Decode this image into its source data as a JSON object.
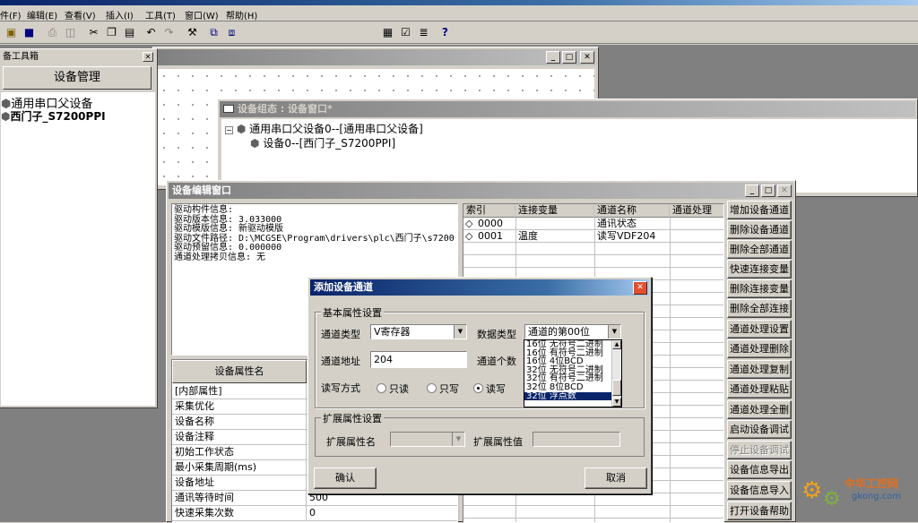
{
  "menu": [
    "件(F)",
    "编辑(E)",
    "查看(V)",
    "插入(I)",
    "工具(T)",
    "窗口(W)",
    "帮助(H)"
  ],
  "toolbox": {
    "title": "备工具箱",
    "header_button": "设备管理",
    "items": [
      "通用串口父设备",
      "西门子_S7200PPI"
    ]
  },
  "device_config": {
    "title": "设备组态 : 设备窗口*",
    "tree_parent": "通用串口父设备0--[通用串口父设备]",
    "tree_child": "设备0--[西门子_S7200PPI]"
  },
  "editor": {
    "title": "设备编辑窗口",
    "info_lines": [
      "驱动构件信息:",
      "驱动版本信息: 3.033000",
      "驱动模版信息: 新驱动模版",
      "驱动文件路径: D:\\MCGSE\\Program\\drivers\\plc\\西门子\\s7200",
      "驱动预留信息: 0.000000",
      "通道处理拷贝信息: 无"
    ],
    "prop_header": "设备属性名",
    "props": [
      {
        "name": "[内部属性]",
        "value": ""
      },
      {
        "name": "采集优化",
        "value": ""
      },
      {
        "name": "设备名称",
        "value": ""
      },
      {
        "name": "设备注释",
        "value": ""
      },
      {
        "name": "初始工作状态",
        "value": ""
      },
      {
        "name": "最小采集周期(ms)",
        "value": ""
      },
      {
        "name": "设备地址",
        "value": ""
      },
      {
        "name": "通讯等待时间",
        "value": "500"
      },
      {
        "name": "快速采集次数",
        "value": "0"
      }
    ],
    "table_headers": [
      "索引",
      "连接变量",
      "通道名称",
      "通道处理"
    ],
    "table_rows": [
      {
        "index": "0000",
        "var": "",
        "name": "通讯状态",
        "proc": ""
      },
      {
        "index": "0001",
        "var": "温度",
        "name": "读写VDF204",
        "proc": ""
      }
    ],
    "buttons": [
      {
        "label": "增加设备通道",
        "enabled": true
      },
      {
        "label": "删除设备通道",
        "enabled": true
      },
      {
        "label": "删除全部通道",
        "enabled": true
      },
      {
        "label": "快速连接变量",
        "enabled": true
      },
      {
        "label": "删除连接变量",
        "enabled": true
      },
      {
        "label": "删除全部连接",
        "enabled": true
      },
      {
        "label": "通道处理设置",
        "enabled": true
      },
      {
        "label": "通道处理删除",
        "enabled": true
      },
      {
        "label": "通道处理复制",
        "enabled": true
      },
      {
        "label": "通道处理粘贴",
        "enabled": true
      },
      {
        "label": "通道处理全删",
        "enabled": true
      },
      {
        "label": "启动设备调试",
        "enabled": true
      },
      {
        "label": "停止设备调试",
        "enabled": false
      },
      {
        "label": "设备信息导出",
        "enabled": true
      },
      {
        "label": "设备信息导入",
        "enabled": true
      },
      {
        "label": "打开设备帮助",
        "enabled": true
      }
    ]
  },
  "dialog": {
    "title": "添加设备通道",
    "basic_group": "基本属性设置",
    "channel_type_label": "通道类型",
    "channel_type_value": "V寄存器",
    "data_type_label": "数据类型",
    "data_type_value": "通道的第00位",
    "address_label": "通道地址",
    "address_value": "204",
    "count_label": "通道个数",
    "rw_label": "读写方式",
    "rw_options": [
      "只读",
      "只写",
      "读写"
    ],
    "rw_selected": 2,
    "data_type_options": [
      "16位 无符号二进制",
      "16位 有符号二进制",
      "16位 4位BCD",
      "32位 无符号二进制",
      "32位 有符号二进制",
      "32位 8位BCD",
      "32位 浮点数"
    ],
    "data_type_selected": 6,
    "ext_group": "扩展属性设置",
    "ext_name_label": "扩展属性名",
    "ext_value_label": "扩展属性值",
    "ok": "确认",
    "cancel": "取消"
  },
  "watermark": {
    "text": "中华工控网",
    "url": "gkong.com"
  }
}
